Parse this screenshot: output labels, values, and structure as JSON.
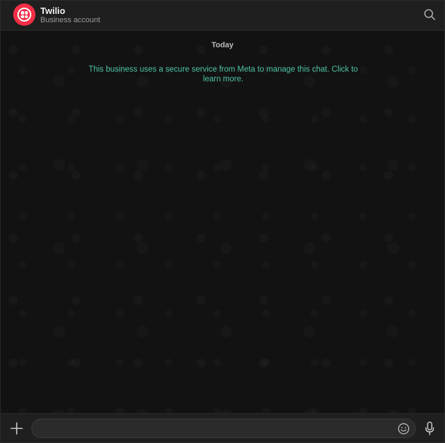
{
  "header": {
    "contact_name": "Twilio",
    "contact_subtitle": "Business account",
    "avatar_icon": "twilio-logo-icon",
    "search_icon": "search-icon",
    "avatar_color": "#f22f46"
  },
  "chat": {
    "date_label": "Today",
    "system_message": "This business uses a secure service from Meta to manage this chat. Click to learn more.",
    "system_message_color": "#4fc3a6"
  },
  "composer": {
    "attach_icon": "plus-icon",
    "input_value": "",
    "emoji_icon": "emoji-icon",
    "mic_icon": "microphone-icon"
  }
}
